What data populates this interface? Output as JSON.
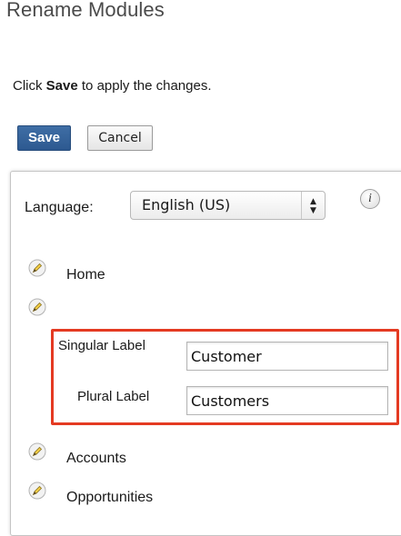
{
  "page": {
    "title": "Rename Modules",
    "instruction_prefix": "Click ",
    "instruction_bold": "Save",
    "instruction_suffix": " to apply the changes."
  },
  "toolbar": {
    "save_label": "Save",
    "cancel_label": "Cancel"
  },
  "language": {
    "label": "Language:",
    "selected": "English (US)",
    "info_icon_glyph": "i"
  },
  "modules": [
    {
      "label": "Home",
      "icon": "pencil-icon"
    },
    {
      "label": "",
      "icon": "pencil-icon"
    },
    {
      "label": "Accounts",
      "icon": "pencil-icon"
    },
    {
      "label": "Opportunities",
      "icon": "pencil-icon"
    }
  ],
  "edit_form": {
    "singular_label": "Singular Label",
    "singular_value": "Customer",
    "plural_label": "Plural Label",
    "plural_value": "Customers",
    "highlight_color": "#e43a22"
  },
  "colors": {
    "save_button": "#2d5990",
    "title_text": "#4a4a4a"
  }
}
